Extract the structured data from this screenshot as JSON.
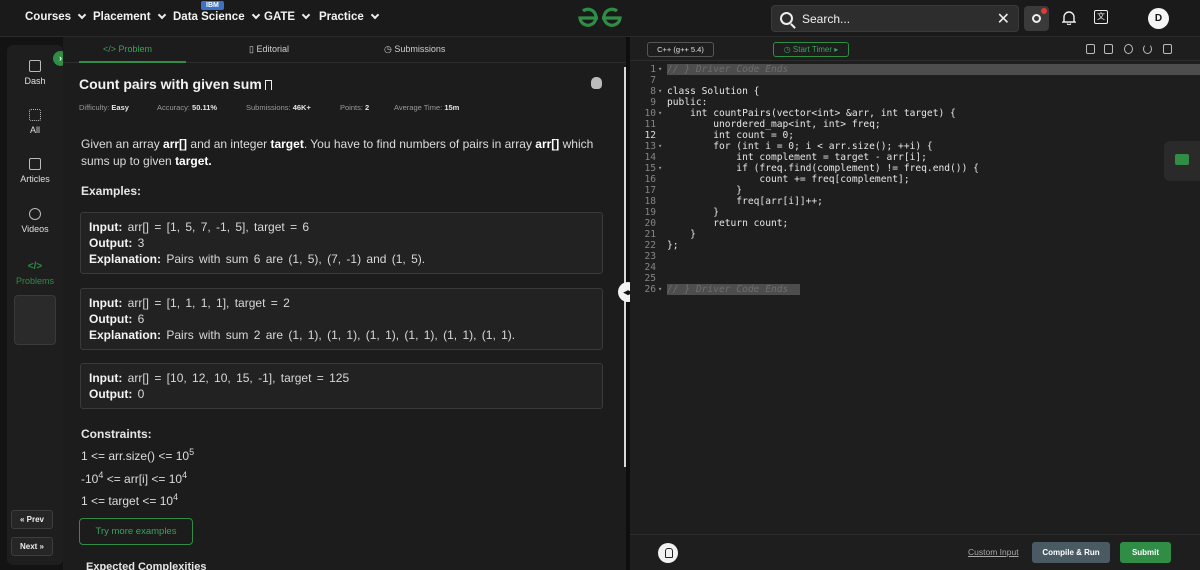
{
  "nav": {
    "items": [
      {
        "label": "Courses"
      },
      {
        "label": "Placement"
      },
      {
        "label": "Data Science"
      },
      {
        "label": "GATE"
      },
      {
        "label": "Practice"
      }
    ],
    "ibm_badge": "IBM",
    "logo_text": "GfG",
    "search_placeholder": "Search...",
    "avatar_initial": "D"
  },
  "rail": {
    "items": [
      {
        "label": "Dash"
      },
      {
        "label": "All"
      },
      {
        "label": "Articles"
      },
      {
        "label": "Videos"
      },
      {
        "label": "Problems"
      }
    ],
    "prev": "« Prev",
    "next": "Next »"
  },
  "tabs": {
    "problem": "</> Problem",
    "editorial": "Editorial",
    "submissions": "Submissions"
  },
  "problem": {
    "title": "Count pairs with given sum",
    "difficulty_label": "Difficulty:",
    "difficulty": "Easy",
    "accuracy_label": "Accuracy:",
    "accuracy": "50.11%",
    "submissions_label": "Submissions:",
    "submissions": "46K+",
    "points_label": "Points:",
    "points": "2",
    "avg_time_label": "Average Time:",
    "avg_time": "15m",
    "desc_1": "Given an array ",
    "desc_arr": "arr[]",
    "desc_2": " and an integer ",
    "desc_target": "target",
    "desc_3": ". You have to find numbers of pairs in array ",
    "desc_arr2": "arr[]",
    "desc_4": " which sums up to given ",
    "desc_target2": "target.",
    "examples_heading": "Examples:",
    "examples": [
      {
        "input": "arr[] = [1, 5, 7, -1, 5], target = 6",
        "output": "3",
        "explanation": "Pairs with sum 6 are (1, 5), (7, -1) and (1, 5)."
      },
      {
        "input": "arr[] = [1, 1, 1, 1], target = 2",
        "output": "6",
        "explanation": "Pairs with sum 2 are (1, 1), (1, 1), (1, 1), (1, 1), (1, 1), (1, 1)."
      },
      {
        "input": "arr[] = [10, 12, 10, 15, -1], target = 125",
        "output": "0"
      }
    ],
    "input_label": "Input:",
    "output_label": "Output:",
    "explanation_label": "Explanation:",
    "constraints_heading": "Constraints:",
    "constraints": [
      {
        "text": "1 <= arr.size() <= 10",
        "sup": "5"
      },
      {
        "pre": "-10",
        "pre_sup": "4",
        "text": " <= arr[i] <= 10",
        "sup": "4"
      },
      {
        "text": "1 <= target <= 10",
        "sup": "4"
      }
    ],
    "try_more": "Try more examples",
    "expected_heading": "Expected Complexities"
  },
  "editor": {
    "language": "C++ (g++ 5.4)",
    "start_timer": "Start Timer",
    "code": [
      {
        "n": "1",
        "t": "// } Driver Code Ends",
        "comment": true,
        "hl": true,
        "fold": true
      },
      {
        "n": "7",
        "t": ""
      },
      {
        "n": "8",
        "t": "class Solution {",
        "fold": true
      },
      {
        "n": "9",
        "t": "public:"
      },
      {
        "n": "10",
        "t": "    int countPairs(vector<int> &arr, int target) {",
        "fold": true
      },
      {
        "n": "11",
        "t": "        unordered_map<int, int> freq;"
      },
      {
        "n": "12",
        "t": "        int count = 0;",
        "cur": true
      },
      {
        "n": "13",
        "t": "        for (int i = 0; i < arr.size(); ++i) {",
        "fold": true
      },
      {
        "n": "14",
        "t": "            int complement = target - arr[i];"
      },
      {
        "n": "15",
        "t": "            if (freq.find(complement) != freq.end()) {",
        "fold": true
      },
      {
        "n": "16",
        "t": "                count += freq[complement];"
      },
      {
        "n": "17",
        "t": "            }"
      },
      {
        "n": "18",
        "t": "            freq[arr[i]]++;"
      },
      {
        "n": "19",
        "t": "        }"
      },
      {
        "n": "20",
        "t": "        return count;"
      },
      {
        "n": "21",
        "t": "    }"
      },
      {
        "n": "22",
        "t": "};"
      },
      {
        "n": "23",
        "t": ""
      },
      {
        "n": "24",
        "t": ""
      },
      {
        "n": "25",
        "t": ""
      },
      {
        "n": "26",
        "t": "// } Driver Code Ends",
        "comment": true,
        "hl": true,
        "fold": true
      }
    ],
    "custom_input": "Custom Input",
    "compile_run": "Compile & Run",
    "submit": "Submit"
  },
  "colors": {
    "accent_green": "#2f8d46",
    "bg": "#1c1c1c"
  }
}
